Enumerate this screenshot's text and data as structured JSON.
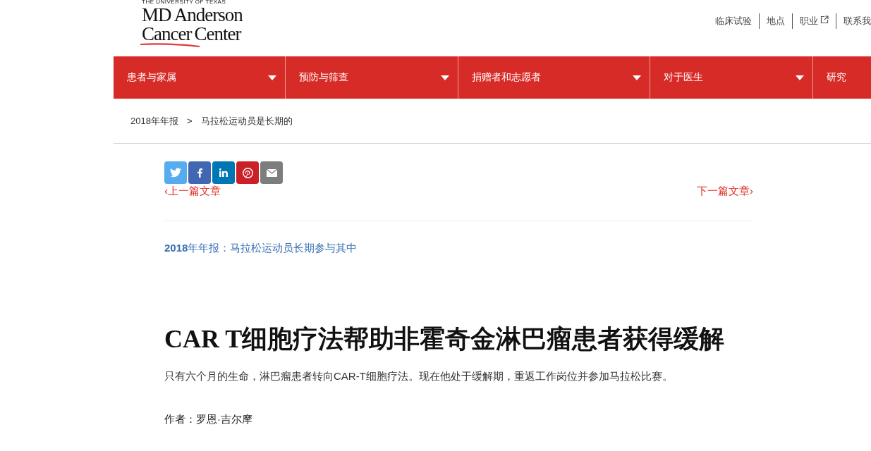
{
  "logo": {
    "university": "THE UNIVERSITY OF TEXAS",
    "line1": "MD Anderson",
    "line2a": "Cancer",
    "line2b": "Center"
  },
  "utility_links": [
    {
      "label": "临床试验",
      "external": false
    },
    {
      "label": "地点",
      "external": false
    },
    {
      "label": "职业",
      "external": true
    },
    {
      "label": "联系我",
      "external": false
    }
  ],
  "nav": [
    {
      "label": "患者与家属",
      "dropdown": true
    },
    {
      "label": "预防与筛查",
      "dropdown": true
    },
    {
      "label": "捐赠者和志愿者",
      "dropdown": true
    },
    {
      "label": "对于医生",
      "dropdown": true
    },
    {
      "label": "研究",
      "dropdown": false
    }
  ],
  "breadcrumb": [
    "2018年年报",
    "马拉松运动员是长期的"
  ],
  "breadcrumb_separator": ">",
  "share": [
    {
      "kind": "twitter",
      "color": "#55acee"
    },
    {
      "kind": "facebook",
      "color": "#4267b2"
    },
    {
      "kind": "linkedin",
      "color": "#0077b5"
    },
    {
      "kind": "pinterest",
      "color": "#cb2027"
    },
    {
      "kind": "email",
      "color": "#7d7d7d"
    }
  ],
  "prev_link": "‹上一篇文章",
  "next_link": "下一篇文章›",
  "series": "**2018**年年报：马拉松运动员长期参与其中",
  "title": "CAR T细胞疗法帮助非霍奇金淋巴瘤患者获得缓解",
  "subtitle": "只有六个月的生命，淋巴瘤患者转向CAR-T细胞疗法。现在他处于缓解期，重返工作岗位并参加马拉松比赛。",
  "author": "作者：罗恩·吉尔摩"
}
